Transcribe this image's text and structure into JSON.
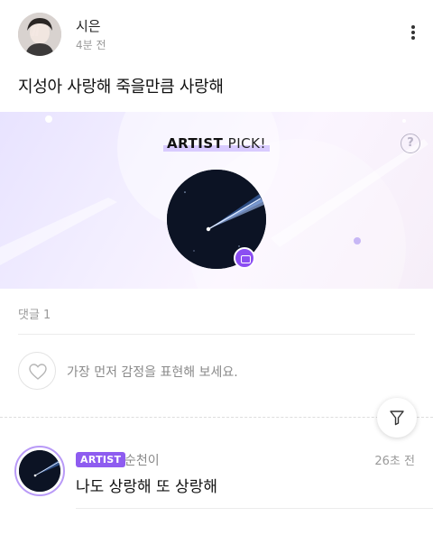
{
  "post": {
    "author": "시은",
    "time": "4분 전",
    "body": "지성아 사랑해 죽을만큼 사랑해"
  },
  "artist_pick": {
    "title_bold": "ARTIST",
    "title_rest": " PICK!",
    "help": "?"
  },
  "comments": {
    "count_label": "댓글 1",
    "react_prompt": "가장 먼저 감정을 표현해 보세요.",
    "items": [
      {
        "badge": "ARTIST",
        "author": "순천이",
        "time": "26초 전",
        "text": "나도 상랑해 또 상랑해"
      }
    ]
  },
  "colors": {
    "accent": "#8e5cf0",
    "banner_bg": "#f1ecff",
    "night_sky": "#0d1426"
  },
  "icons": [
    "more-vertical-icon",
    "help-icon",
    "message-badge-icon",
    "heart-icon",
    "filter-icon"
  ]
}
